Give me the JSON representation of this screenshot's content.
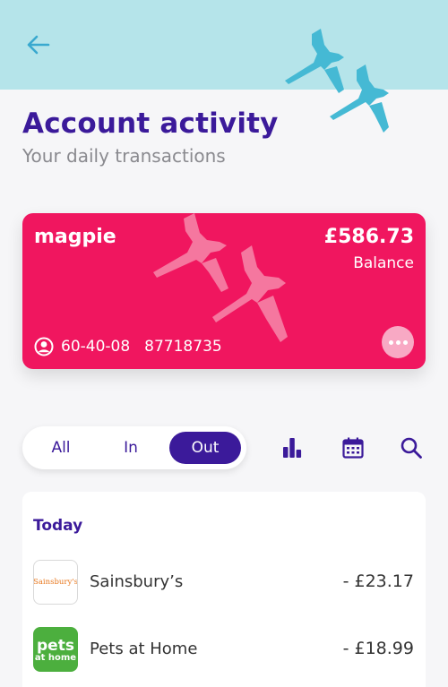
{
  "header": {
    "title": "Account activity",
    "subtitle": "Your daily transactions",
    "accent": "#3b1a9a",
    "bar_color": "#b5e4ea",
    "back_icon": "arrow-left-icon",
    "decoration_icon": "magpie-birds-icon"
  },
  "card": {
    "name": "magpie",
    "balance": "£586.73",
    "balance_label": "Balance",
    "sort_code": "60-40-08",
    "account_number": "87718735",
    "color": "#f0165f",
    "account_icon": "user-circle-icon",
    "more_icon": "more-dots-icon"
  },
  "filter": {
    "tabs": [
      {
        "label": "All",
        "selected": false
      },
      {
        "label": "In",
        "selected": false
      },
      {
        "label": "Out",
        "selected": true
      }
    ]
  },
  "toolbar": {
    "icons": [
      "bar-chart-icon",
      "calendar-icon",
      "search-icon"
    ]
  },
  "transactions": {
    "section": "Today",
    "items": [
      {
        "merchant": "Sainsbury’s",
        "amount": "- £23.17",
        "logo_text": "Sainsbury's"
      },
      {
        "merchant": "Pets at Home",
        "amount": "- £18.99",
        "logo_text_1": "pets",
        "logo_text_2": "at home"
      }
    ]
  }
}
